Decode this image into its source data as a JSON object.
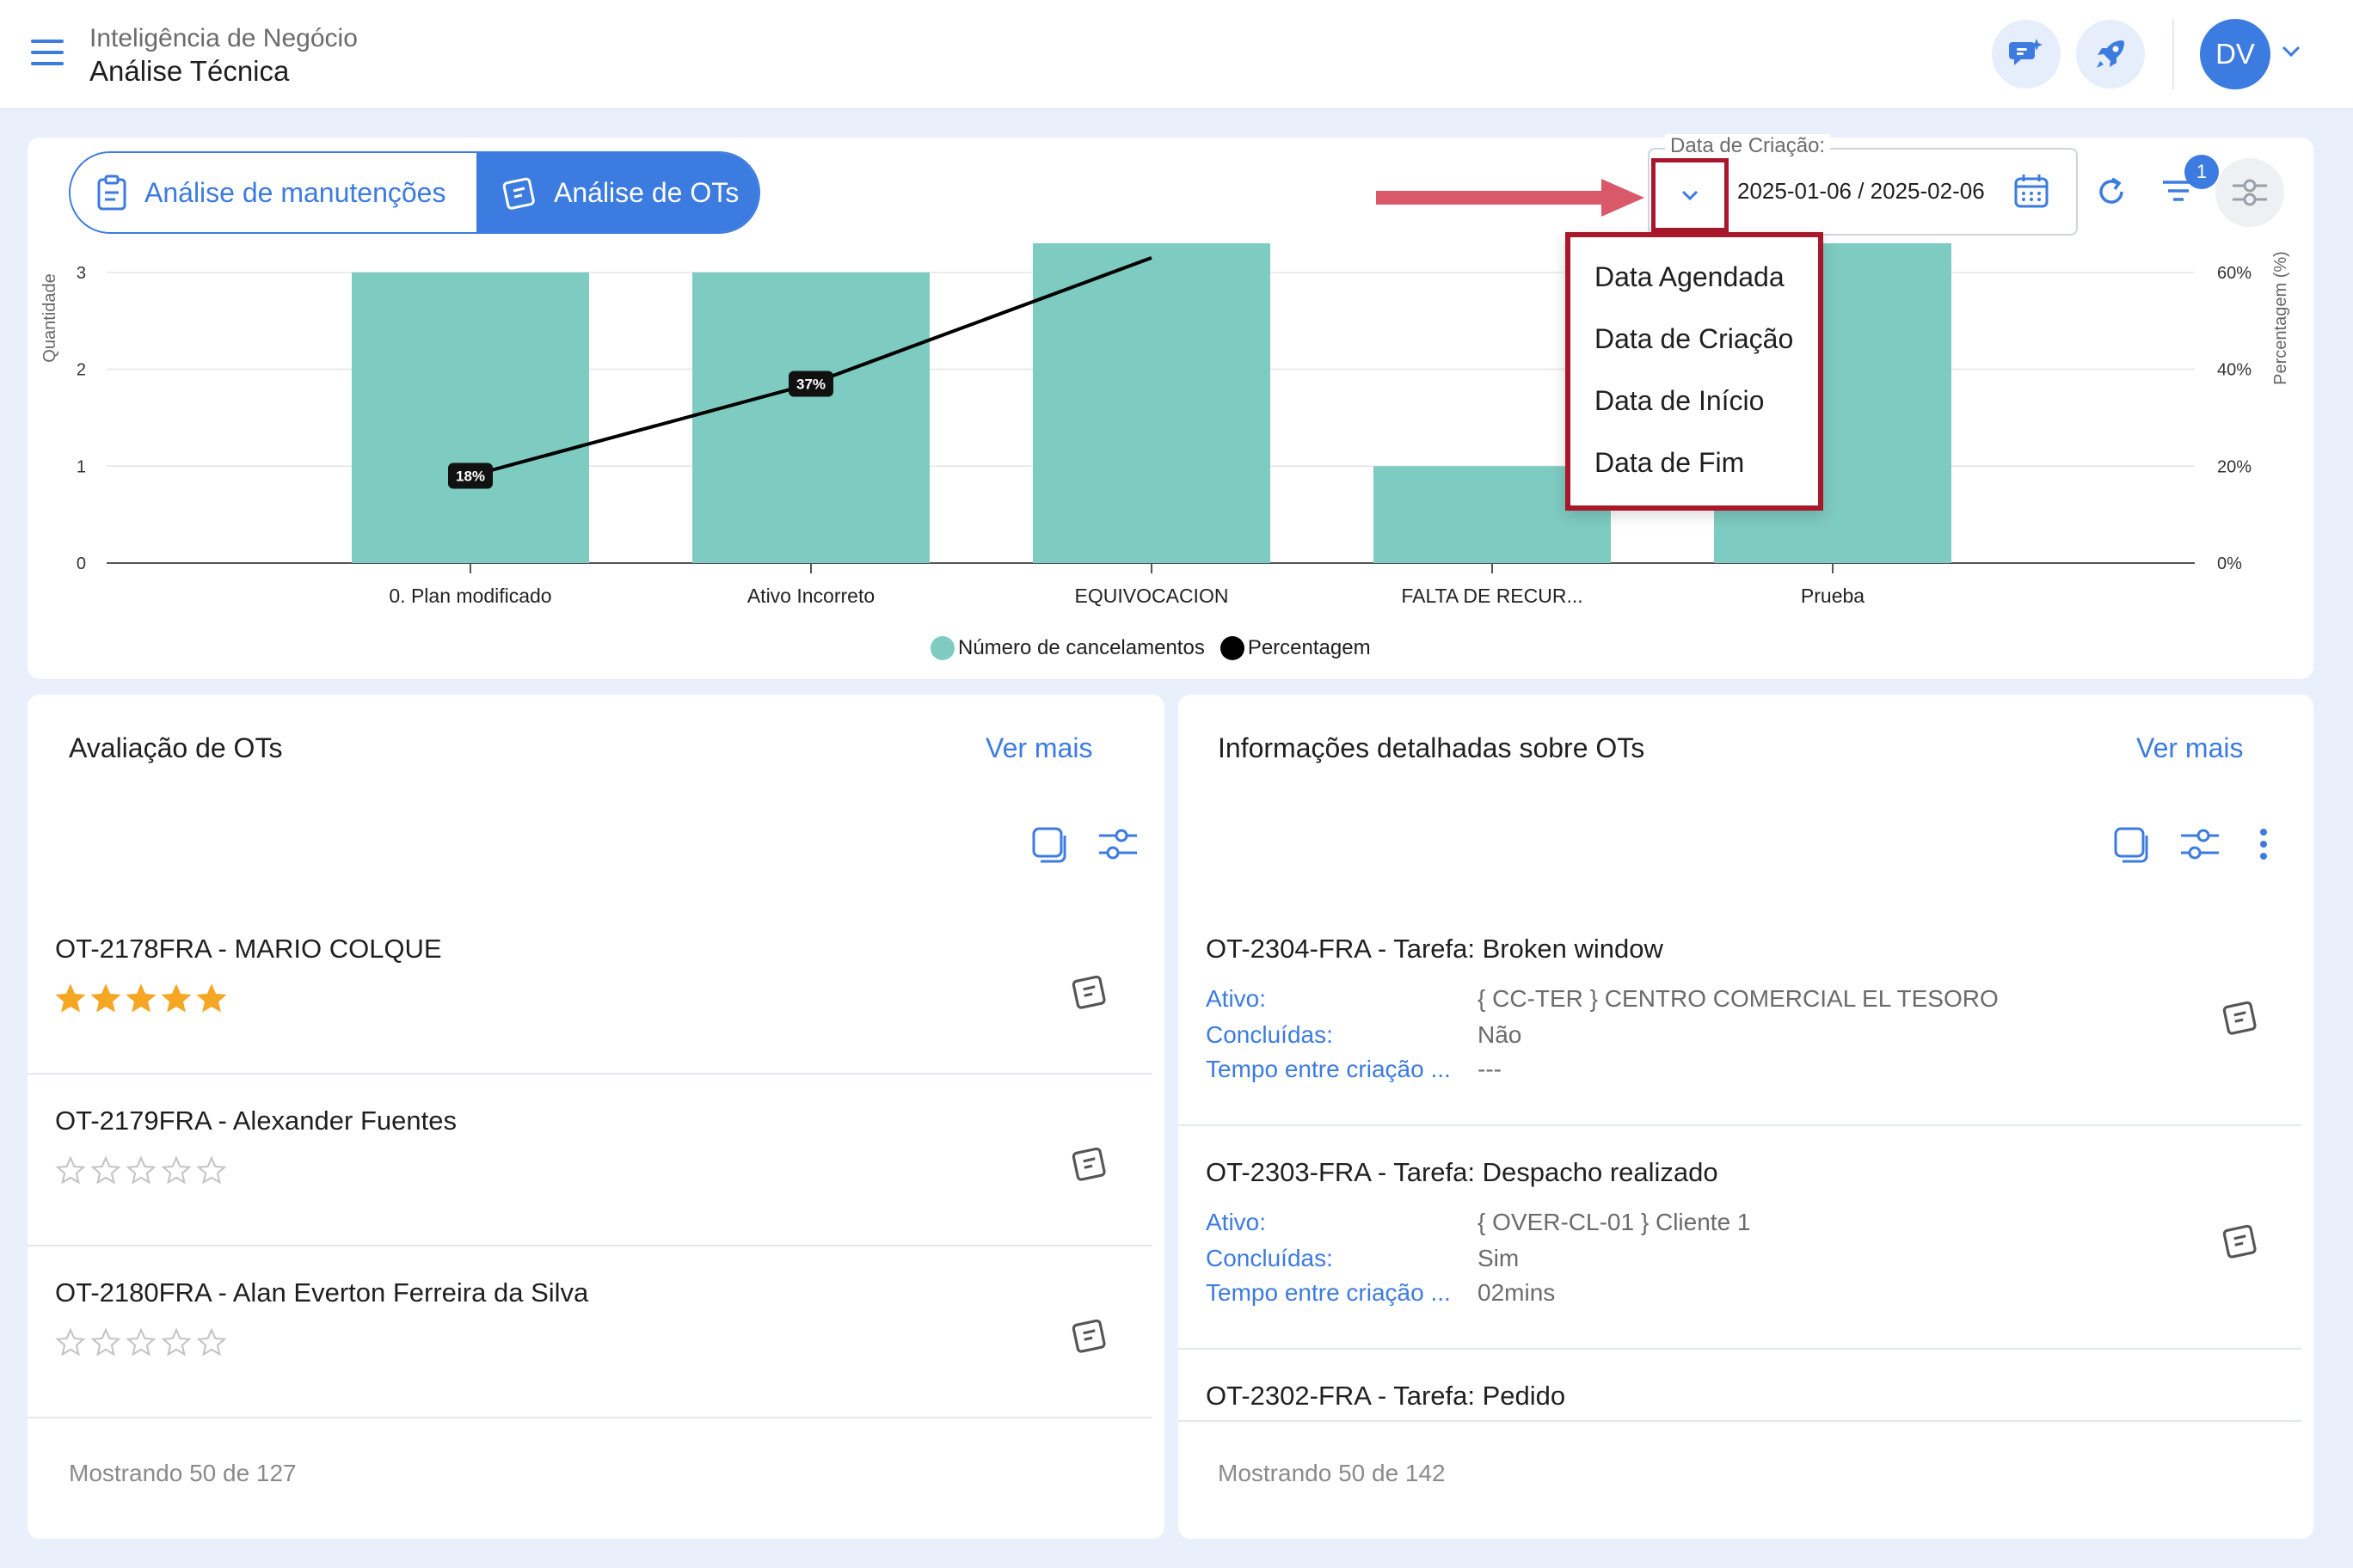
{
  "header": {
    "breadcrumb_parent": "Inteligência de Negócio",
    "breadcrumb_current": "Análise Técnica",
    "avatar_initials": "DV"
  },
  "tabs": [
    {
      "label": "Análise de manutenções",
      "icon": "clipboard-icon",
      "active": false
    },
    {
      "label": "Análise de OTs",
      "icon": "work-order-icon",
      "active": true
    }
  ],
  "date_filter": {
    "label": "Data de Criação:",
    "value": "2025-01-06 / 2025-02-06",
    "options": [
      "Data Agendada",
      "Data de Criação",
      "Data de Início",
      "Data de Fim"
    ]
  },
  "filter_badge_count": "1",
  "colors": {
    "accent": "#3c7be0",
    "bar": "#7ecbc1",
    "highlight": "#a8182a",
    "arrow": "#d9596a"
  },
  "chart_data": {
    "type": "bar",
    "categories": [
      "0. Plan modificado",
      "Ativo Incorreto",
      "EQUIVOCACION",
      "FALTA DE RECUR...",
      "Prueba"
    ],
    "series": [
      {
        "name": "Número de cancelamentos",
        "type": "bar",
        "values": [
          3,
          3,
          3.3,
          1,
          3.3
        ]
      },
      {
        "name": "Percentagem",
        "type": "line",
        "values": [
          18,
          37,
          63
        ]
      }
    ],
    "point_labels": [
      "18%",
      "37%"
    ],
    "ylabel": "Quantidade",
    "y2label": "Percentagem (%)",
    "y_ticks": [
      "0",
      "1",
      "2",
      "3"
    ],
    "y2_ticks": [
      "0%",
      "20%",
      "40%",
      "60%"
    ],
    "ylim": [
      0,
      3.3
    ],
    "y2lim": [
      0,
      66
    ],
    "legend": "bottom"
  },
  "evaluation": {
    "title": "Avaliação de OTs",
    "more": "Ver mais",
    "footer": "Mostrando 50 de 127",
    "items": [
      {
        "title": "OT-2178FRA - MARIO COLQUE",
        "rating": 5
      },
      {
        "title": "OT-2179FRA - Alexander Fuentes",
        "rating": 0
      },
      {
        "title": "OT-2180FRA - Alan Everton Ferreira da Silva",
        "rating": 0
      }
    ]
  },
  "details": {
    "title": "Informações detalhadas sobre OTs",
    "more": "Ver mais",
    "footer": "Mostrando 50 de 142",
    "keys": {
      "asset": "Ativo:",
      "completed": "Concluídas:",
      "time": "Tempo entre criação ..."
    },
    "items": [
      {
        "title": "OT-2304-FRA - Tarefa: Broken window",
        "asset": "{ CC-TER } CENTRO COMERCIAL EL TESORO",
        "completed": "Não",
        "time": "---"
      },
      {
        "title": "OT-2303-FRA - Tarefa: Despacho realizado",
        "asset": "{ OVER-CL-01 } Cliente 1",
        "completed": "Sim",
        "time": "02mins"
      },
      {
        "title": "OT-2302-FRA - Tarefa: Pedido"
      }
    ]
  }
}
